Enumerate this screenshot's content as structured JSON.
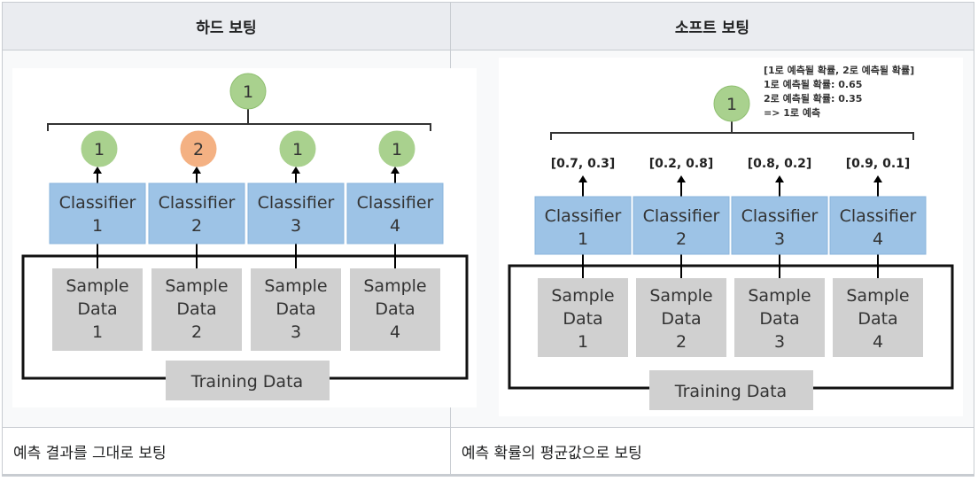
{
  "table": {
    "headers": [
      "하드 보팅",
      "소프트 보팅"
    ],
    "captions": [
      "예측 결과를 그대로 보팅",
      "예측 확률의 평균값으로 보팅"
    ]
  },
  "hard_voting": {
    "final": "1",
    "predictions": [
      "1",
      "2",
      "1",
      "1"
    ],
    "classifier_label": "Classifier",
    "sample_label": [
      "Sample",
      "Data"
    ],
    "indices": [
      "1",
      "2",
      "3",
      "4"
    ],
    "training_label": "Training Data"
  },
  "soft_voting": {
    "final": "1",
    "probabilities": [
      "[0.7, 0.3]",
      "[0.2, 0.8]",
      "[0.8, 0.2]",
      "[0.9, 0.1]"
    ],
    "notes": [
      "[1로 예측될 확률, 2로 예측될 확률]",
      "1로 예측될 확률: 0.65",
      "2로 예측될 확률: 0.35",
      "=> 1로 예측"
    ],
    "classifier_label": "Classifier",
    "sample_label": [
      "Sample",
      "Data"
    ],
    "indices": [
      "1",
      "2",
      "3",
      "4"
    ],
    "training_label": "Training Data"
  },
  "colors": {
    "green": "#a9d18e",
    "orange": "#f4b183",
    "blue": "#9dc3e6",
    "gray": "#d0d0d0"
  }
}
